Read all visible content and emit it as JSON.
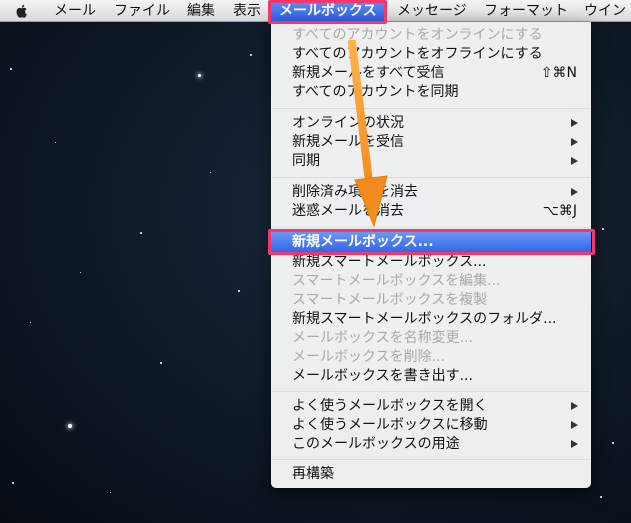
{
  "menubar": {
    "apple_icon": "apple-icon",
    "items": [
      "メール",
      "ファイル",
      "編集",
      "表示",
      "メールボックス",
      "メッセージ",
      "フォーマット",
      "ウイン"
    ],
    "active": "メールボックス"
  },
  "mailbox_menu": {
    "items": [
      {
        "label": "すべてのアカウントをオンラインにする",
        "enabled": false
      },
      {
        "label": "すべてのアカウントをオフラインにする",
        "enabled": true
      },
      {
        "label": "新規メールをすべて受信",
        "shortcut": "⇧⌘N",
        "enabled": true
      },
      {
        "label": "すべてのアカウントを同期",
        "enabled": true
      },
      {
        "label": "オンラインの状況",
        "submenu": true,
        "enabled": true
      },
      {
        "label": "新規メールを受信",
        "submenu": true,
        "enabled": true
      },
      {
        "label": "同期",
        "submenu": true,
        "enabled": true
      },
      {
        "label": "削除済み項目を消去",
        "submenu": true,
        "enabled": true
      },
      {
        "label": "迷惑メールを消去",
        "shortcut": "⌥⌘J",
        "enabled": true
      },
      {
        "label": "新規メールボックス...",
        "enabled": true,
        "selected": true
      },
      {
        "label": "新規スマートメールボックス...",
        "enabled": true
      },
      {
        "label": "スマートメールボックスを編集...",
        "enabled": false
      },
      {
        "label": "スマートメールボックスを複製",
        "enabled": false
      },
      {
        "label": "新規スマートメールボックスのフォルダ...",
        "enabled": true
      },
      {
        "label": "メールボックスを名称変更...",
        "enabled": false
      },
      {
        "label": "メールボックスを削除...",
        "enabled": false
      },
      {
        "label": "メールボックスを書き出す...",
        "enabled": true
      },
      {
        "label": "よく使うメールボックスを開く",
        "submenu": true,
        "enabled": true
      },
      {
        "label": "よく使うメールボックスに移動",
        "submenu": true,
        "enabled": true
      },
      {
        "label": "このメールボックスの用途",
        "submenu": true,
        "enabled": true
      },
      {
        "label": "再構築",
        "enabled": true
      }
    ]
  },
  "colors": {
    "highlight": "#3263e6",
    "annotation_box": "#f0386b",
    "annotation_arrow": "#f39a2a"
  }
}
